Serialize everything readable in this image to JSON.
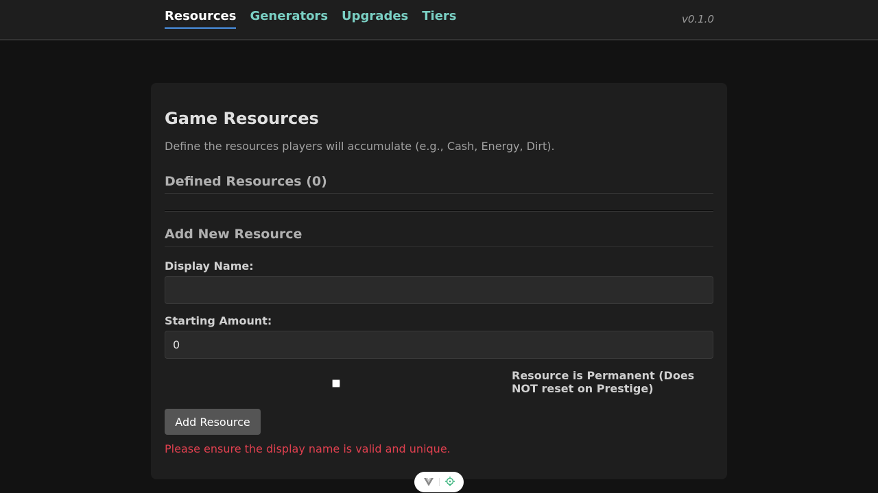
{
  "nav": {
    "tabs": [
      {
        "label": "Resources",
        "active": true
      },
      {
        "label": "Generators",
        "active": false
      },
      {
        "label": "Upgrades",
        "active": false
      },
      {
        "label": "Tiers",
        "active": false
      }
    ],
    "version": "v0.1.0"
  },
  "page": {
    "title": "Game Resources",
    "description": "Define the resources players will accumulate (e.g., Cash, Energy, Dirt).",
    "defined_heading": "Defined Resources (0)",
    "add_heading": "Add New Resource"
  },
  "form": {
    "display_name_label": "Display Name:",
    "display_name_value": "",
    "starting_amount_label": "Starting Amount:",
    "starting_amount_value": "0",
    "permanent_checked": false,
    "permanent_label": "Resource is Permanent (Does NOT reset on Prestige)",
    "submit_label": "Add Resource",
    "error_message": "Please ensure the display name is valid and unique."
  },
  "colors": {
    "background": "#121212",
    "panel": "#1e1e1e",
    "nav_link": "#7ad0c4",
    "active_underline": "#4a90e2",
    "error": "#e0404f",
    "button": "#555555"
  },
  "devtools": {
    "icons": [
      "vue-logo-icon",
      "inspector-target-icon"
    ]
  }
}
